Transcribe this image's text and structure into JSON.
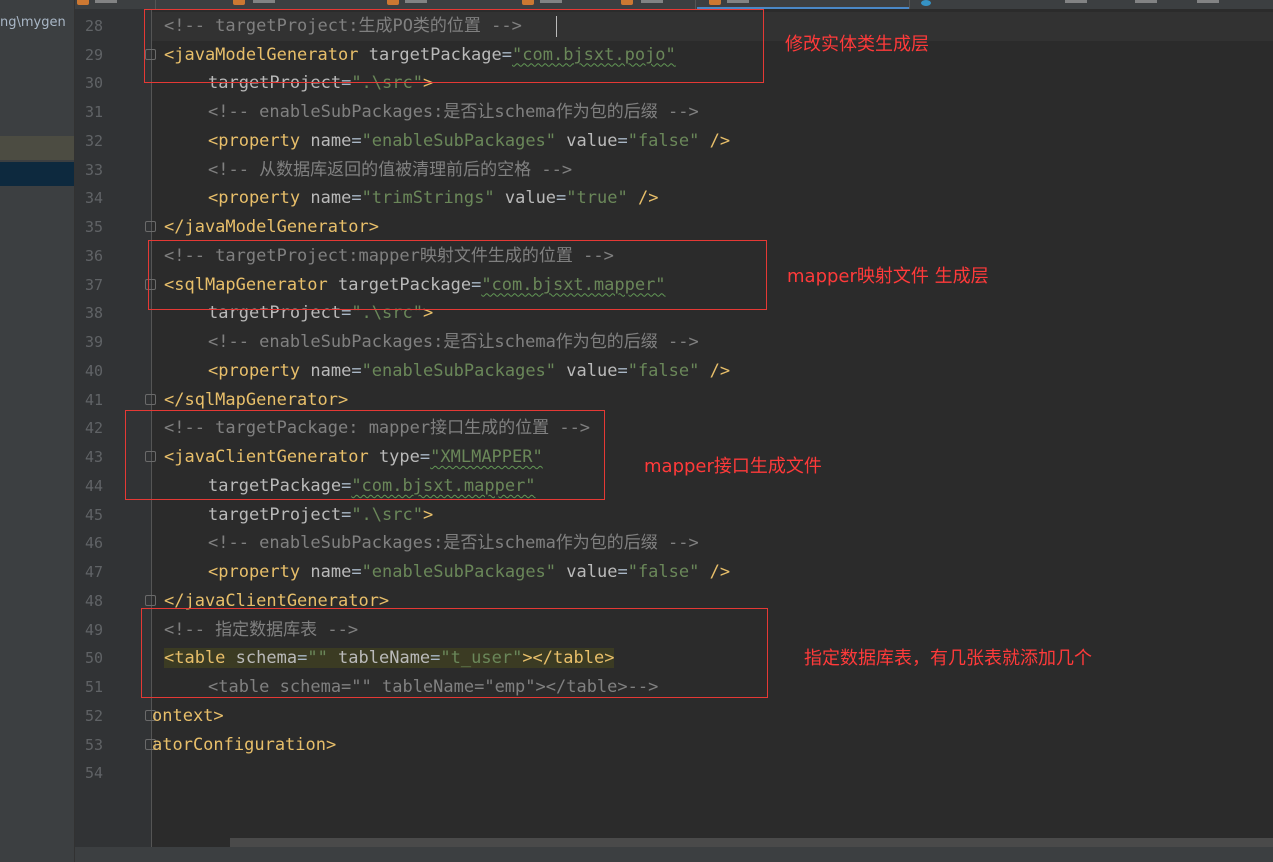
{
  "project_panel": {
    "path_fragment": "ng\\mygen"
  },
  "gutter": {
    "line_numbers": [
      "28",
      "29",
      "30",
      "31",
      "32",
      "33",
      "34",
      "35",
      "36",
      "37",
      "38",
      "39",
      "40",
      "41",
      "42",
      "43",
      "44",
      "45",
      "46",
      "47",
      "48",
      "49",
      "50",
      "51",
      "52",
      "53",
      "54"
    ]
  },
  "code": {
    "l28": {
      "comment": "<!-- targetProject:生成PO类的位置 -->"
    },
    "l29": {
      "open": "<javaModelGenerator",
      "attr1": " targetPackage",
      "val1": "\"com.bjsxt.pojo\""
    },
    "l30": {
      "attr1": "targetProject",
      "val1": "\".\\src\"",
      "close": ">"
    },
    "l31": {
      "comment": "<!-- enableSubPackages:是否让schema作为包的后缀 -->"
    },
    "l32": {
      "open": "<property",
      "attr1": " name",
      "val1": "\"enableSubPackages\"",
      "attr2": " value",
      "val2": "\"false\"",
      "close": " />"
    },
    "l33": {
      "comment": "<!-- 从数据库返回的值被清理前后的空格 -->"
    },
    "l34": {
      "open": "<property",
      "attr1": " name",
      "val1": "\"trimStrings\"",
      "attr2": " value",
      "val2": "\"true\"",
      "close": " />"
    },
    "l35": {
      "tag": "</javaModelGenerator>"
    },
    "l36": {
      "comment": "<!-- targetProject:mapper映射文件生成的位置 -->"
    },
    "l37": {
      "open": "<sqlMapGenerator",
      "attr1": " targetPackage",
      "val1": "\"com.bjsxt.mapper\""
    },
    "l38": {
      "attr1": "targetProject",
      "val1": "\".\\src\"",
      "close": ">"
    },
    "l39": {
      "comment": "<!-- enableSubPackages:是否让schema作为包的后缀 -->"
    },
    "l40": {
      "open": "<property",
      "attr1": " name",
      "val1": "\"enableSubPackages\"",
      "attr2": " value",
      "val2": "\"false\"",
      "close": " />"
    },
    "l41": {
      "tag": "</sqlMapGenerator>"
    },
    "l42": {
      "comment": "<!-- targetPackage: mapper接口生成的位置 -->"
    },
    "l43": {
      "open": "<javaClientGenerator",
      "attr1": " type",
      "val1": "\"XMLMAPPER\""
    },
    "l44": {
      "attr1": "targetPackage",
      "val1": "\"com.bjsxt.mapper\""
    },
    "l45": {
      "attr1": "targetProject",
      "val1": "\".\\src\"",
      "close": ">"
    },
    "l46": {
      "comment": "<!-- enableSubPackages:是否让schema作为包的后缀 -->"
    },
    "l47": {
      "open": "<property",
      "attr1": " name",
      "val1": "\"enableSubPackages\"",
      "attr2": " value",
      "val2": "\"false\"",
      "close": " />"
    },
    "l48": {
      "tag": "</javaClientGenerator>"
    },
    "l49": {
      "comment": "<!-- 指定数据库表 -->"
    },
    "l50": {
      "open": "<table",
      "attr1": " schema",
      "val1": "\"\"",
      "attr2": " tableName",
      "val2": "\"t_user\"",
      "close": "></table>"
    },
    "l51": {
      "comment": "<table schema=\"\" tableName=\"emp\"></table>-->"
    },
    "l52": {
      "tag": "ontext>"
    },
    "l53": {
      "tag": "atorConfiguration>"
    }
  },
  "annotations": {
    "model": "修改实体类生成层",
    "sqlmap": "mapper映射文件 生成层",
    "client": "mapper接口生成文件",
    "table": "指定数据库表，有几张表就添加几个"
  },
  "colors": {
    "tag": "#e8bf6a",
    "attribute": "#bababa",
    "value": "#6a8759",
    "comment": "#808080",
    "annotation": "#ff3a3a"
  }
}
